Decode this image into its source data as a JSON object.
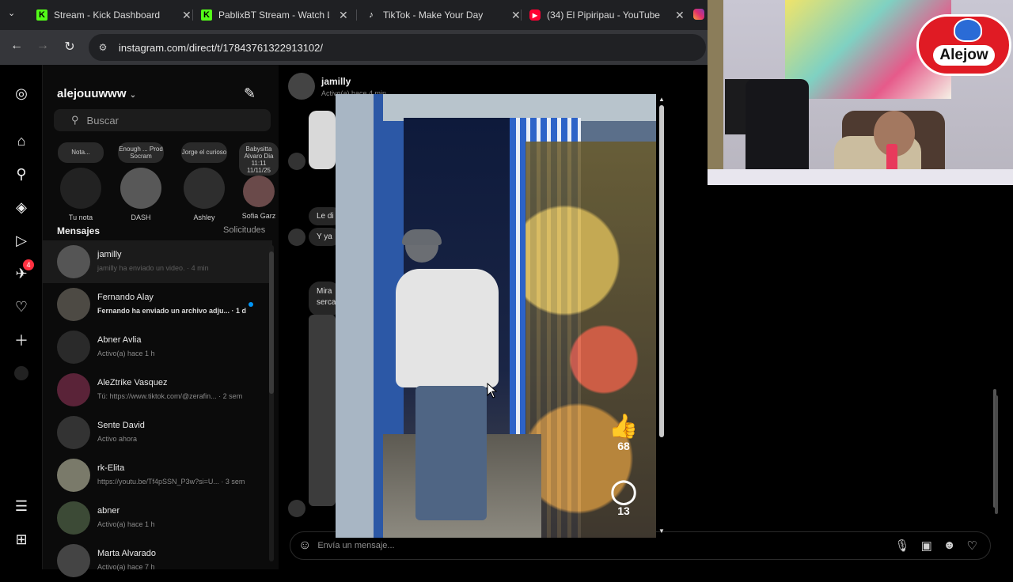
{
  "browser": {
    "tabs": [
      {
        "label": "Stream - Kick Dashboard",
        "favicon": "kick-icon"
      },
      {
        "label": "PablixBT Stream - Watch Live",
        "favicon": "kick-icon"
      },
      {
        "label": "TikTok - Make Your Day",
        "favicon": "tiktok-icon"
      },
      {
        "label": "(34) El Pipiripau - YouTube",
        "favicon": "youtube-icon"
      }
    ],
    "url": "instagram.com/direct/t/17843761322913102/",
    "accent": "#53fc18"
  },
  "rail": {
    "notifications_badge": "4"
  },
  "inbox": {
    "username": "alejouuwww",
    "search_placeholder": "Buscar",
    "notes": [
      {
        "bubble": "Nota...",
        "label": "Tu nota"
      },
      {
        "bubble": "Enough ... Prod Socram",
        "label": "DASH"
      },
      {
        "bubble": "Jorge el curioso",
        "label": "Ashley"
      },
      {
        "bubble": "Babysitta Alvaro Dia 11:11 11/11/25",
        "label": "Sofia Garz"
      }
    ],
    "messages_title": "Mensajes",
    "requests_label": "Solicitudes",
    "threads": [
      {
        "name": "jamilly",
        "preview": "jamilly ha enviado un video. · 4 min"
      },
      {
        "name": "Fernando Alay",
        "preview": "Fernando ha enviado un archivo adju... · 1 d"
      },
      {
        "name": "Abner Avlia",
        "preview": "Activo(a) hace 1 h"
      },
      {
        "name": "AleZtrike Vasquez",
        "preview": "Tú: https://www.tiktok.com/@zerafin... · 2 sem"
      },
      {
        "name": "Sente David",
        "preview": "Activo ahora"
      },
      {
        "name": "rk-Elita",
        "preview": "https://youtu.be/Tf4pSSN_P3w?si=U... · 3 sem"
      },
      {
        "name": "abner",
        "preview": "Activo(a) hace 1 h"
      },
      {
        "name": "Marta Alvarado",
        "preview": "Activo(a) hace 7 h"
      }
    ]
  },
  "conversation": {
    "name": "jamilly",
    "status": "Activo(a) hace 4 min",
    "snippets": [
      "Le di",
      "Y ya",
      "Mira",
      "serca"
    ],
    "composer_placeholder": "Envía un mensaje..."
  },
  "video": {
    "likes": "68",
    "comments": "13"
  },
  "webcam": {
    "logo_text": "Alejow"
  }
}
